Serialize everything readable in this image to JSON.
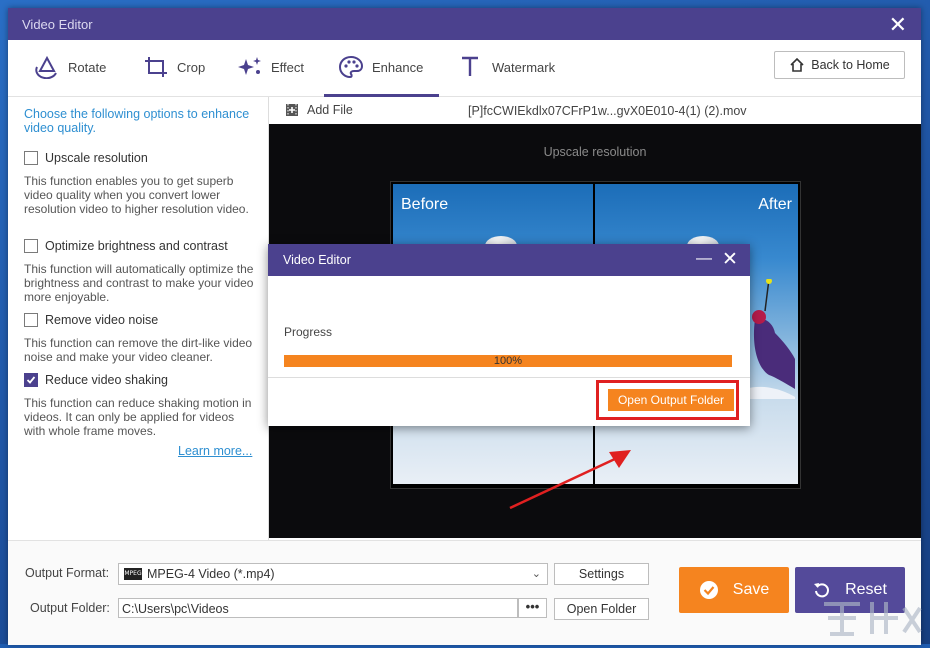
{
  "window": {
    "title": "Video Editor"
  },
  "toolbar": {
    "tabs": [
      {
        "label": "Rotate",
        "icon": "rotate-icon"
      },
      {
        "label": "Crop",
        "icon": "crop-icon"
      },
      {
        "label": "Effect",
        "icon": "effect-icon"
      },
      {
        "label": "Enhance",
        "icon": "palette-icon",
        "active": true
      },
      {
        "label": "Watermark",
        "icon": "text-icon"
      }
    ],
    "back_label": "Back to Home"
  },
  "enhance": {
    "intro": "Choose the following options to enhance video quality.",
    "options": [
      {
        "label": "Upscale resolution",
        "checked": false,
        "desc": "This function enables you to get superb video quality when you convert lower resolution video to higher resolution video."
      },
      {
        "label": "Optimize brightness and contrast",
        "checked": false,
        "desc": "This function will automatically optimize the brightness and contrast to make your video more enjoyable."
      },
      {
        "label": "Remove video noise",
        "checked": false,
        "desc": "This function can remove the dirt-like video noise and make your video cleaner."
      },
      {
        "label": "Reduce video shaking",
        "checked": true,
        "desc": "This function can reduce shaking motion in videos. It can only be applied for videos with whole frame moves."
      }
    ],
    "learn_more": "Learn more..."
  },
  "file": {
    "add_label": "Add File",
    "name": "[P]fcCWIEkdlx07CFrP1w...gvX0E010-4(1) (2).mov"
  },
  "preview": {
    "caption": "Upscale resolution",
    "before_label": "Before",
    "after_label": "After"
  },
  "output": {
    "format_label": "Output Format:",
    "format_value": "MPEG-4 Video (*.mp4)",
    "format_badge": "MPEG",
    "settings_label": "Settings",
    "folder_label": "Output Folder:",
    "folder_value": "C:\\Users\\pc\\Videos",
    "browse_label": "•••",
    "open_folder_label": "Open Folder",
    "save_label": "Save",
    "reset_label": "Reset"
  },
  "dialog": {
    "title": "Video Editor",
    "progress_label": "Progress",
    "progress_text": "100%",
    "progress_value": 1.0,
    "open_output_label": "Open Output Folder"
  },
  "colors": {
    "accent": "#4b418e",
    "orange": "#f5841f",
    "link": "#2e8fd1",
    "highlight": "#e02020"
  }
}
